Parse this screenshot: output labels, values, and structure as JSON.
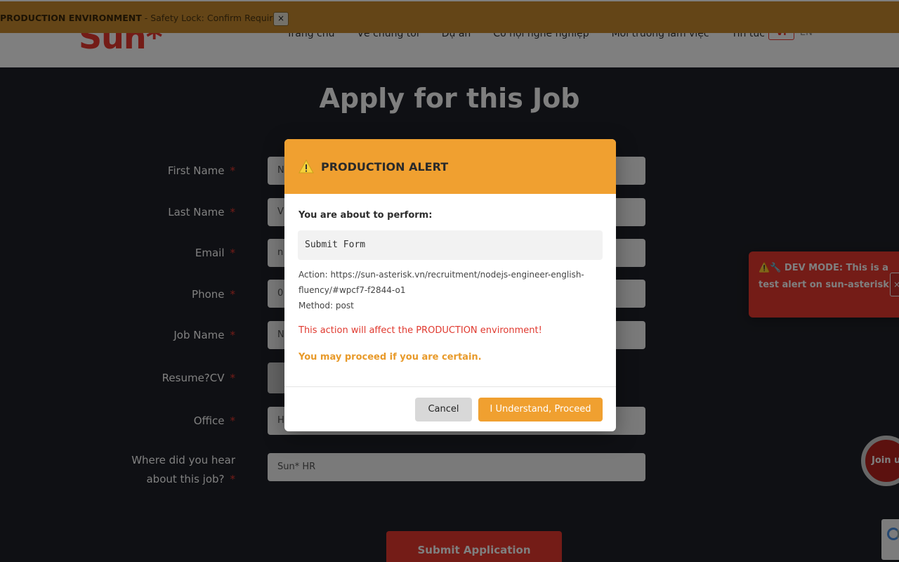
{
  "banner": {
    "env_label": "PRODUCTION ENVIRONMENT",
    "lock_label": " - Safety Lock: Confirm Required",
    "close_glyph": "×"
  },
  "header": {
    "logo": "Sun*",
    "nav": [
      "Trang chủ",
      "Về chúng tôi",
      "Dự án",
      "Cơ hội nghề nghiệp",
      "Môi trường làm việc",
      "Tin tức"
    ],
    "lang_vi": "VI",
    "lang_en": "EN"
  },
  "page": {
    "title": "Apply for this Job",
    "required_mark": "*",
    "fields": [
      {
        "label": "First Name",
        "value": "N"
      },
      {
        "label": "Last Name",
        "value": "V"
      },
      {
        "label": "Email",
        "value": "n"
      },
      {
        "label": "Phone",
        "value": "0"
      },
      {
        "label": "Job Name",
        "value": "N"
      },
      {
        "label": "Resume?CV",
        "value": ""
      },
      {
        "label": "Office",
        "value": "H"
      }
    ],
    "hear_label_line1": "Where did you hear",
    "hear_label_line2": "about this job?",
    "hear_value": "Sun* HR",
    "submit_label": "Submit Application"
  },
  "toast": {
    "warn_icons": "⚠️🔧",
    "text": "DEV MODE: This is a test alert on sun-asterisk.vn",
    "close_glyph": "×"
  },
  "join_us": "Join us",
  "modal": {
    "title": "PRODUCTION ALERT",
    "subtitle": "You are about to perform:",
    "action_name": "Submit Form",
    "action_url_line1": "Action: https://sun-asterisk.vn/recruitment/nodejs-engineer-english-",
    "action_url_line2": "fluency/#wpcf7-f2844-o1",
    "method": "Method: post",
    "danger": "This action will affect the PRODUCTION environment!",
    "proceed_note": "You may proceed if you are certain.",
    "cancel_label": "Cancel",
    "confirm_label": "I Understand, Proceed"
  },
  "colors": {
    "brand_red": "#e8382f",
    "alert_orange": "#f0a030",
    "banner_bg": "#c88a2e"
  }
}
